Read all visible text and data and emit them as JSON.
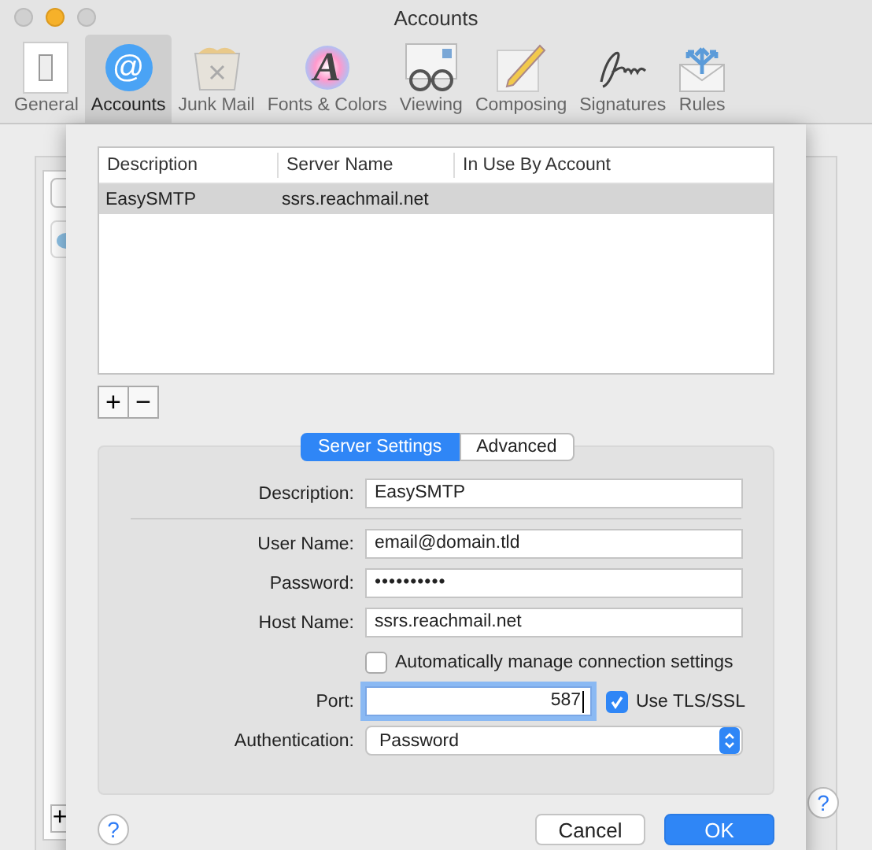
{
  "window": {
    "title": "Accounts"
  },
  "toolbar": [
    {
      "label": "General",
      "kind": "switch",
      "selected": false
    },
    {
      "label": "Accounts",
      "kind": "at",
      "glyph": "@",
      "selected": true
    },
    {
      "label": "Junk Mail",
      "kind": "trash",
      "selected": false
    },
    {
      "label": "Fonts & Colors",
      "kind": "font",
      "glyph": "A",
      "selected": false
    },
    {
      "label": "Viewing",
      "kind": "glasses",
      "selected": false
    },
    {
      "label": "Composing",
      "kind": "pencil",
      "selected": false
    },
    {
      "label": "Signatures",
      "kind": "signature",
      "selected": false
    },
    {
      "label": "Rules",
      "kind": "rules",
      "selected": false
    }
  ],
  "background": {
    "add_button": "+",
    "help_button": "?"
  },
  "sheet": {
    "table": {
      "columns": [
        "Description",
        "Server Name",
        "In Use By Account"
      ],
      "rows": [
        {
          "cells": [
            "EasySMTP",
            "ssrs.reachmail.net",
            ""
          ],
          "selected": true
        }
      ]
    },
    "list_buttons": [
      "+",
      "−"
    ],
    "tabs": [
      {
        "label": "Server Settings",
        "selected": true
      },
      {
        "label": "Advanced",
        "selected": false
      }
    ],
    "fields": [
      {
        "kind": "text",
        "label": "Description:",
        "value": "EasySMTP"
      },
      {
        "kind": "separator"
      },
      {
        "kind": "text",
        "label": "User Name:",
        "value": "email@domain.tld"
      },
      {
        "kind": "password",
        "label": "Password:",
        "value": "••••••••••"
      },
      {
        "kind": "text",
        "label": "Host Name:",
        "value": "ssrs.reachmail.net"
      },
      {
        "kind": "checkbox",
        "label": "Automatically manage connection settings",
        "checked": false
      },
      {
        "kind": "port",
        "label": "Port:",
        "value": "587",
        "checkbox_label": "Use TLS/SSL",
        "checked": true
      },
      {
        "kind": "select",
        "label": "Authentication:",
        "value": "Password"
      }
    ],
    "help_button": "?",
    "buttons": [
      {
        "label": "Cancel",
        "kind": "default"
      },
      {
        "label": "OK",
        "kind": "primary"
      }
    ]
  }
}
